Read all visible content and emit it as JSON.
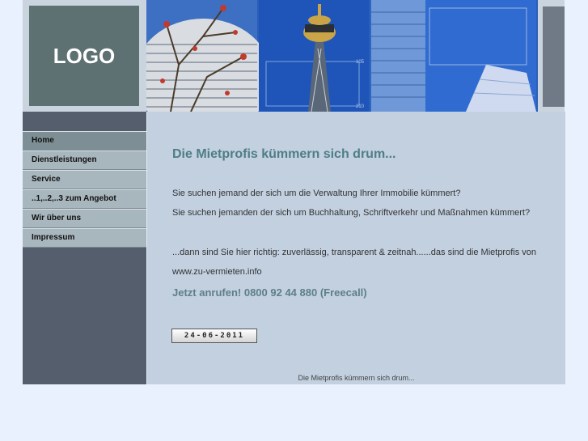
{
  "logo": {
    "text": "LOGO"
  },
  "nav": {
    "items": [
      {
        "label": "Home"
      },
      {
        "label": "Dienstleistungen"
      },
      {
        "label": "Service"
      },
      {
        "label": "..1,..2,..3 zum Angebot"
      },
      {
        "label": "Wir über uns"
      },
      {
        "label": "Impressum"
      }
    ]
  },
  "banner": {
    "number_1": "105",
    "number_2": "210"
  },
  "main": {
    "headline": "Die Mietprofis kümmern sich drum...",
    "line1": "Sie suchen jemand der sich um die Verwaltung Ihrer Immobilie kümmert?",
    "line2": "Sie suchen jemanden der sich um Buchhaltung, Schriftverkehr und Maßnahmen kümmert?",
    "line3": "...dann sind Sie hier richtig: zuverlässig, transparent & zeitnah......das sind die Mietprofis von",
    "line4": "www.zu-vermieten.info",
    "call": "Jetzt anrufen! 0800 92 44 880 (Freecall)",
    "date": "24-06-2011",
    "footer": "Die Mietprofis kümmern sich drum..."
  },
  "colors": {
    "headline": "#4f7d86",
    "sidebar": "#545e6d",
    "content_bg": "#c2d0e0"
  }
}
